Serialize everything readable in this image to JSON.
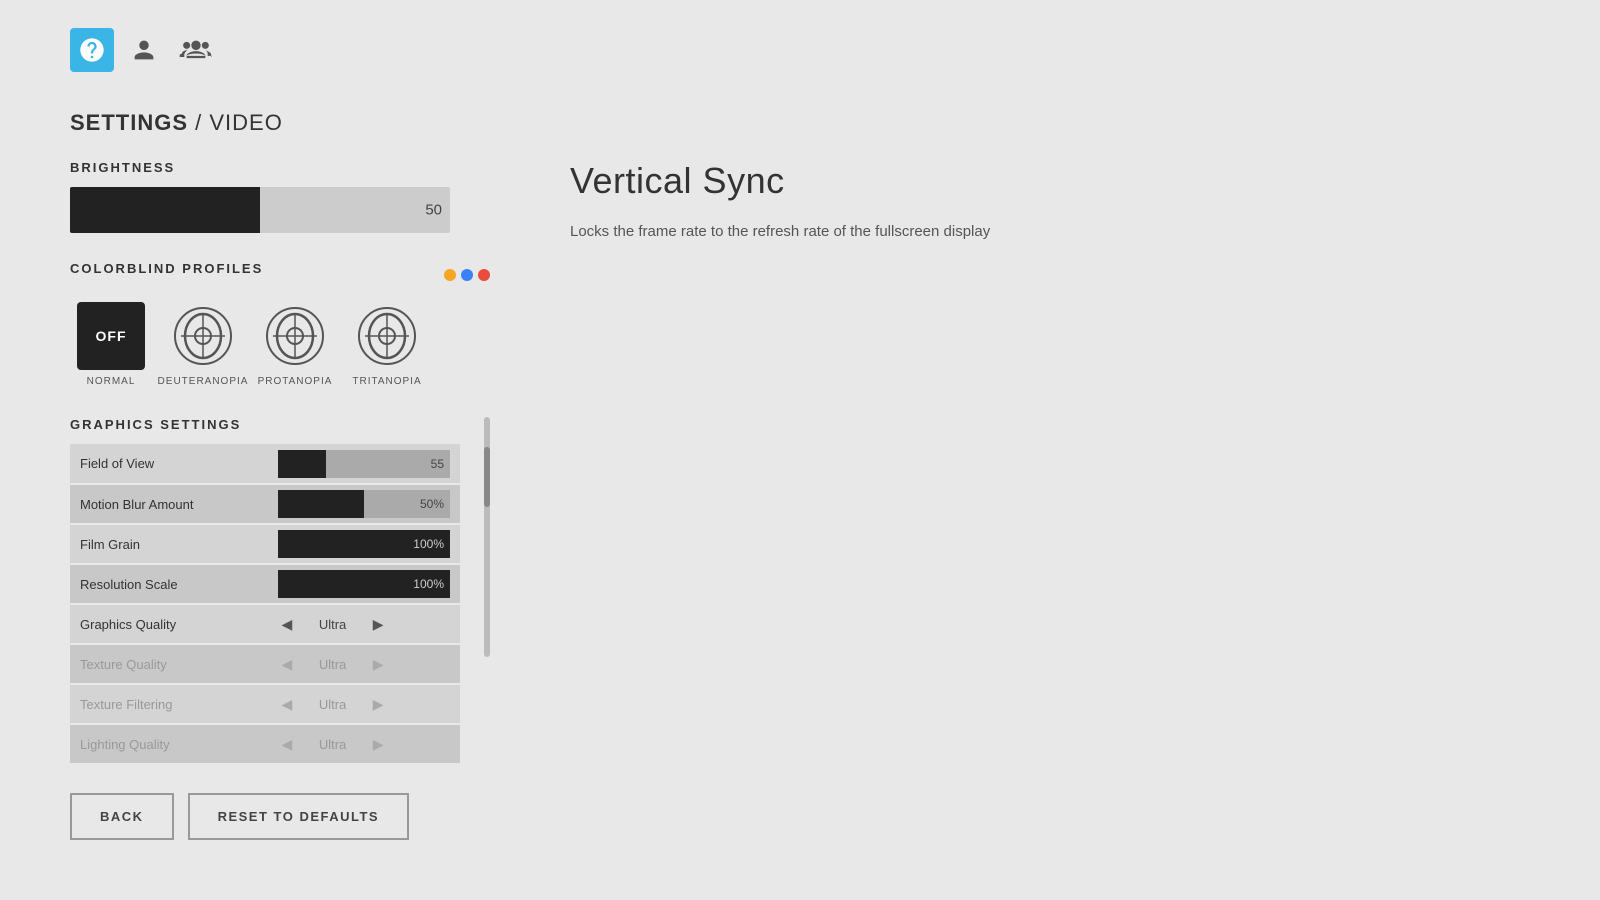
{
  "nav": {
    "icons": [
      {
        "name": "help-icon",
        "type": "help",
        "active": true
      },
      {
        "name": "profile-icon",
        "type": "profile",
        "active": false
      },
      {
        "name": "group-icon",
        "type": "group",
        "active": false
      }
    ]
  },
  "page": {
    "title_bold": "SETTINGS",
    "title_normal": " / VIDEO"
  },
  "brightness": {
    "label": "BRIGHTNESS",
    "value": 50,
    "fill_percent": 50
  },
  "colorblind": {
    "label": "COLORBLIND PROFILES",
    "dots": [
      {
        "color": "#f5a623"
      },
      {
        "color": "#3b82f6"
      },
      {
        "color": "#e74c3c"
      }
    ],
    "options": [
      {
        "id": "off",
        "label": "NORMAL",
        "type": "off"
      },
      {
        "id": "deuteranopia",
        "label": "DEUTERANOPIA",
        "type": "eye"
      },
      {
        "id": "protanopia",
        "label": "PROTANOPIA",
        "type": "eye"
      },
      {
        "id": "tritanopia",
        "label": "TRITANOPIA",
        "type": "eye"
      }
    ]
  },
  "graphics": {
    "label": "GRAPHICS SETTINGS",
    "settings": [
      {
        "name": "Field of View",
        "type": "slider",
        "value": 55,
        "fill_percent": 28,
        "dimmed": false
      },
      {
        "name": "Motion Blur Amount",
        "type": "slider",
        "value": "50%",
        "fill_percent": 50,
        "dimmed": false
      },
      {
        "name": "Film Grain",
        "type": "slider",
        "value": "100%",
        "fill_percent": 100,
        "dimmed": false
      },
      {
        "name": "Resolution Scale",
        "type": "slider",
        "value": "100%",
        "fill_percent": 100,
        "dimmed": false
      },
      {
        "name": "Graphics Quality",
        "type": "select",
        "value": "Ultra",
        "dimmed": false
      },
      {
        "name": "Texture Quality",
        "type": "select",
        "value": "Ultra",
        "dimmed": true
      },
      {
        "name": "Texture Filtering",
        "type": "select",
        "value": "Ultra",
        "dimmed": true
      },
      {
        "name": "Lighting Quality",
        "type": "select",
        "value": "Ultra",
        "dimmed": true
      }
    ]
  },
  "info": {
    "title": "Vertical Sync",
    "description": "Locks the frame rate to the refresh rate of the fullscreen display"
  },
  "buttons": {
    "back_label": "BACK",
    "reset_label": "RESET TO DEFAULTS"
  }
}
